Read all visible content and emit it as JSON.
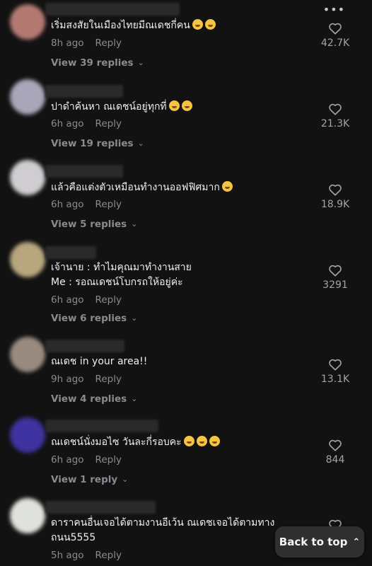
{
  "top_menu_icon": "more-horizontal-icon",
  "comments": [
    {
      "lines": [
        "เริ่มสงสัยในเมืองไทยมีณเดชกี่คน"
      ],
      "emojis": 2,
      "time": "8h ago",
      "reply": "Reply",
      "view_replies": "View 39 replies",
      "likes": "42.7K",
      "avatar_color": "#c88a80"
    },
    {
      "lines": [
        "ปาดำค้นหา ณเดชน์อยู่ทุกที่"
      ],
      "emojis": 2,
      "time": "6h ago",
      "reply": "Reply",
      "view_replies": "View 19 replies",
      "likes": "21.3K",
      "avatar_color": "#b9b6c8"
    },
    {
      "lines": [
        "แล้วคือแต่งตัวเหมือนทำงานออฟฟิศมาก"
      ],
      "emojis": 1,
      "time": "6h ago",
      "reply": "Reply",
      "view_replies": "View 5 replies",
      "likes": "18.9K",
      "avatar_color": "#d8d6d8"
    },
    {
      "lines": [
        "เจ้านาย : ทำไมคุณมาทำงานสาย",
        "Me : รอณเดชน์โบกรถให้อยู่ค่ะ"
      ],
      "emojis": 0,
      "time": "6h ago",
      "reply": "Reply",
      "view_replies": "View 6 replies",
      "likes": "3291",
      "avatar_color": "#c6b48e"
    },
    {
      "lines": [
        "ณเดช in your area!!"
      ],
      "emojis": 0,
      "time": "9h ago",
      "reply": "Reply",
      "view_replies": "View 4 replies",
      "likes": "13.1K",
      "avatar_color": "#a8988c"
    },
    {
      "lines": [
        "ณเดชน์นั่งมอไซ วันละกี่รอบคะ"
      ],
      "emojis": 3,
      "time": "6h ago",
      "reply": "Reply",
      "view_replies": "View 1 reply",
      "likes": "844",
      "avatar_color": "#4b3fb0"
    },
    {
      "lines": [
        "ดาราคนอื่นเจอได้ตามงานอีเว้น ณเดชเจอได้ตามทาง",
        "ถนน5555"
      ],
      "emojis": 0,
      "time": "5h ago",
      "reply": "Reply",
      "view_replies": "",
      "likes": "",
      "avatar_color": "#e4e6e2"
    }
  ],
  "back_to_top": {
    "label": "Back to top",
    "icon": "double-chevron-up-icon"
  }
}
